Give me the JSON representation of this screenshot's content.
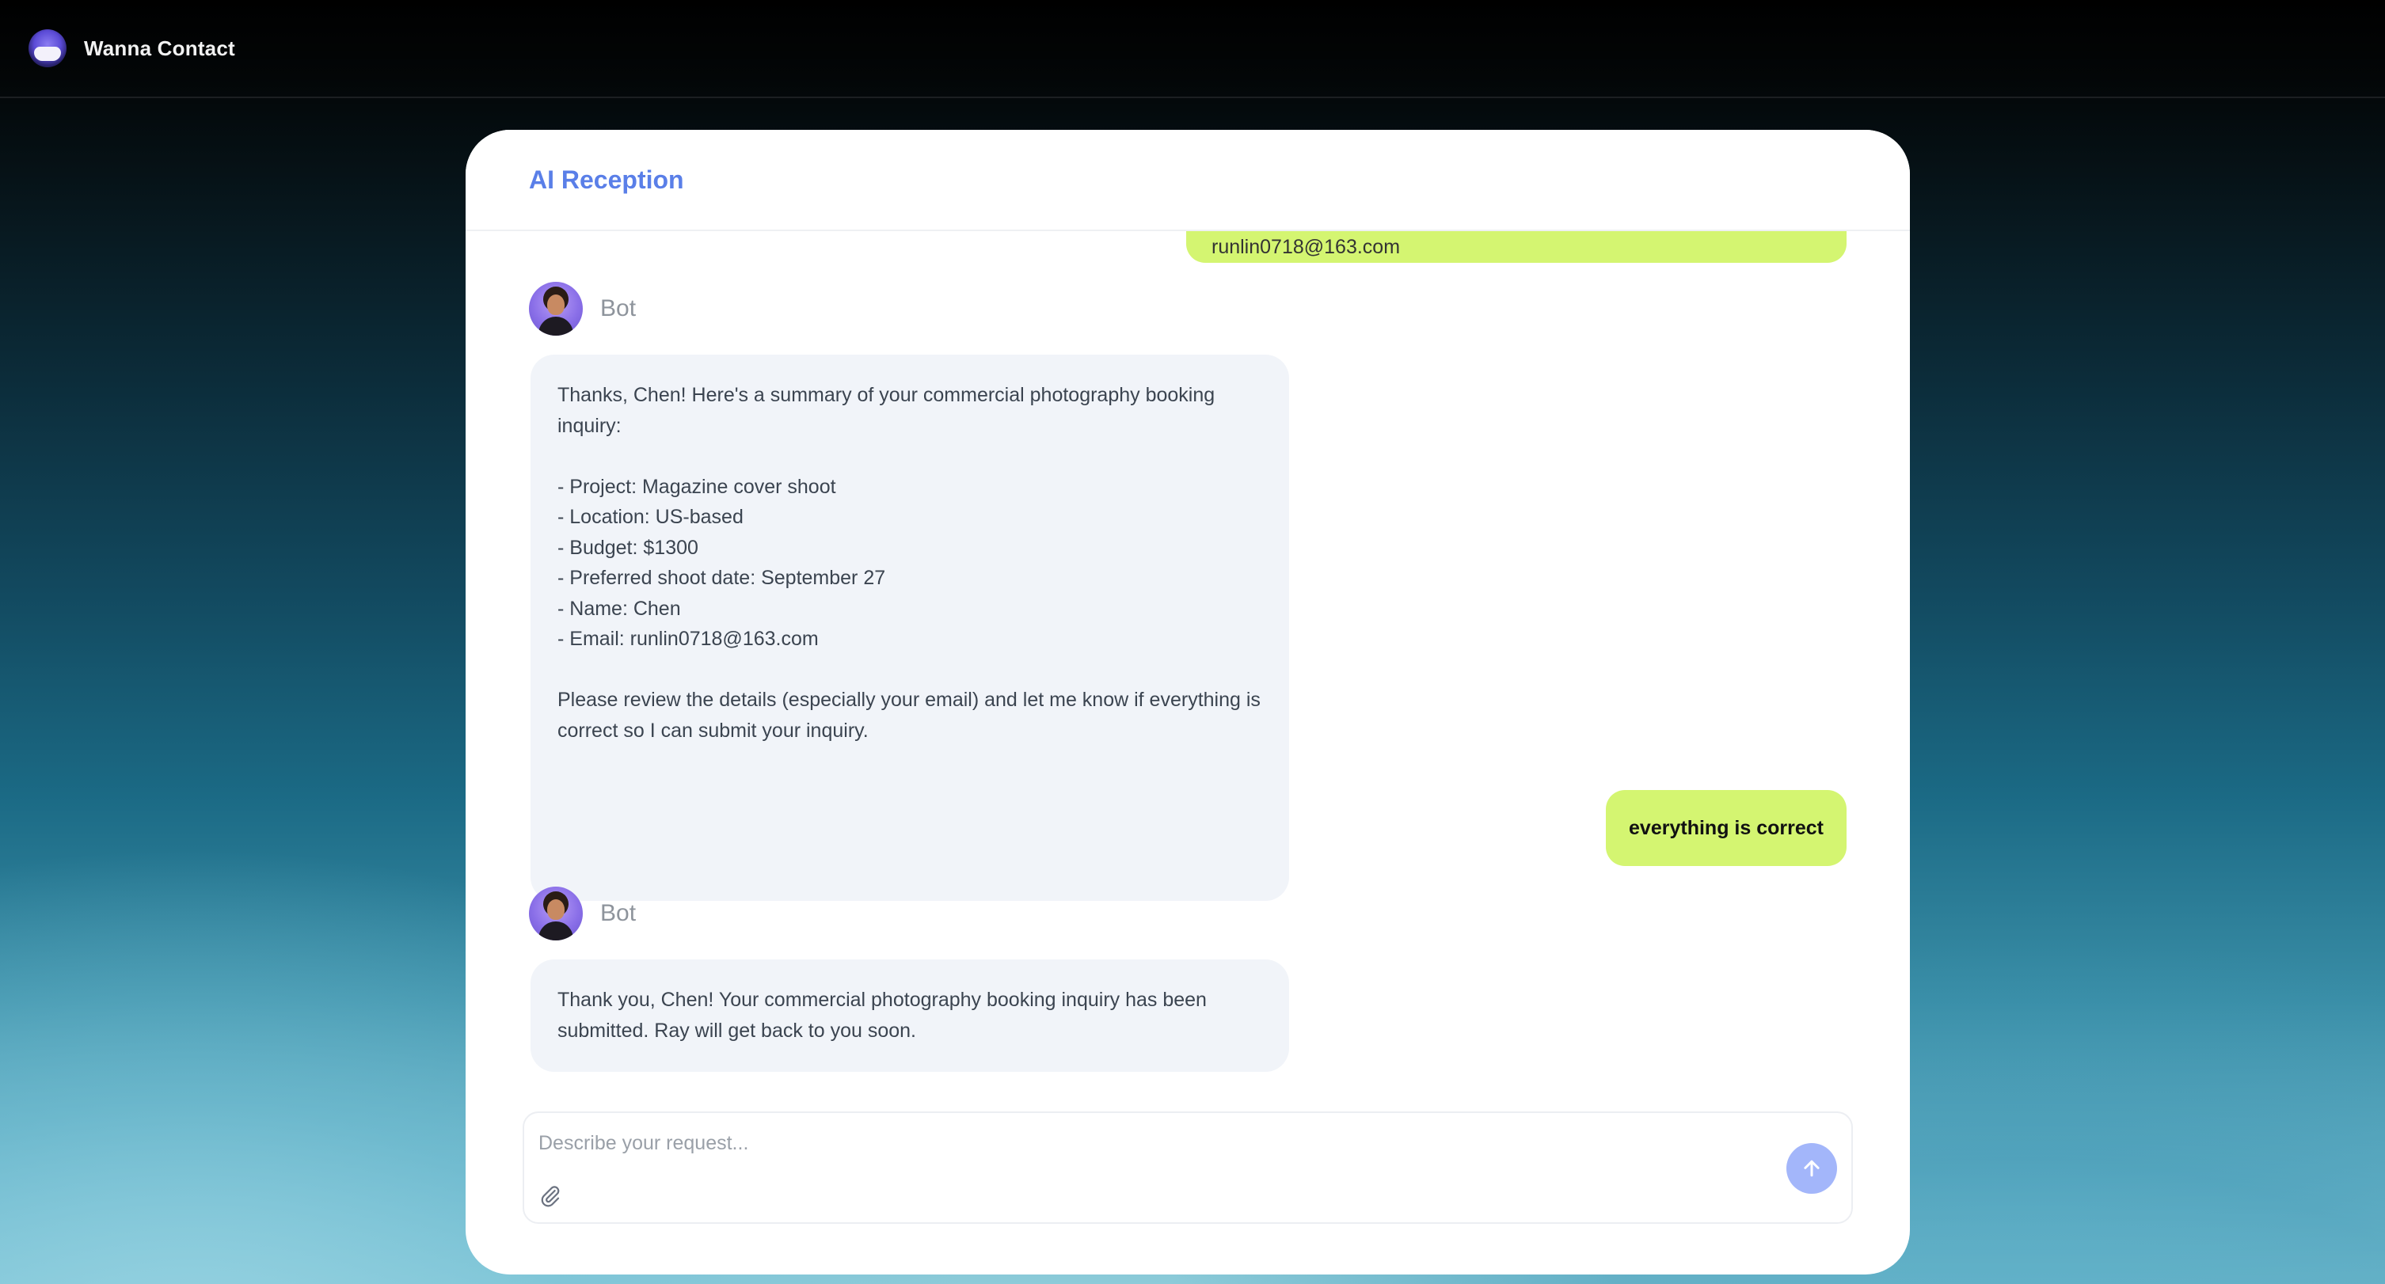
{
  "app": {
    "brand": "Wanna Contact"
  },
  "card": {
    "title": "AI Reception"
  },
  "messages": [
    {
      "role": "user",
      "partial_text": "runlin0718@163.com"
    },
    {
      "role": "bot",
      "author": "Bot",
      "text": "Thanks, Chen! Here's a summary of your commercial photography booking inquiry:\n\n- Project: Magazine cover shoot\n- Location: US-based\n- Budget: $1300\n- Preferred shoot date: September 27\n- Name: Chen\n- Email: runlin0718@163.com\n\nPlease review the details (especially your email) and let me know if everything is correct so I can submit your inquiry."
    },
    {
      "role": "user",
      "text": "everything is correct"
    },
    {
      "role": "bot",
      "author": "Bot",
      "text": "Thank you, Chen! Your commercial photography booking inquiry has been submitted. Ray will get back to you soon."
    }
  ],
  "composer": {
    "placeholder": "Describe your request...",
    "value": ""
  },
  "icons": {
    "logo": "app-logo-icon",
    "avatar": "bot-avatar-icon",
    "attach": "paperclip-icon",
    "send": "arrow-up-icon"
  },
  "colors": {
    "accent": "#5a7fe8",
    "user_bubble": "#d4f571",
    "bot_bubble": "#f1f4f9",
    "send_button": "#a3b6fa"
  }
}
